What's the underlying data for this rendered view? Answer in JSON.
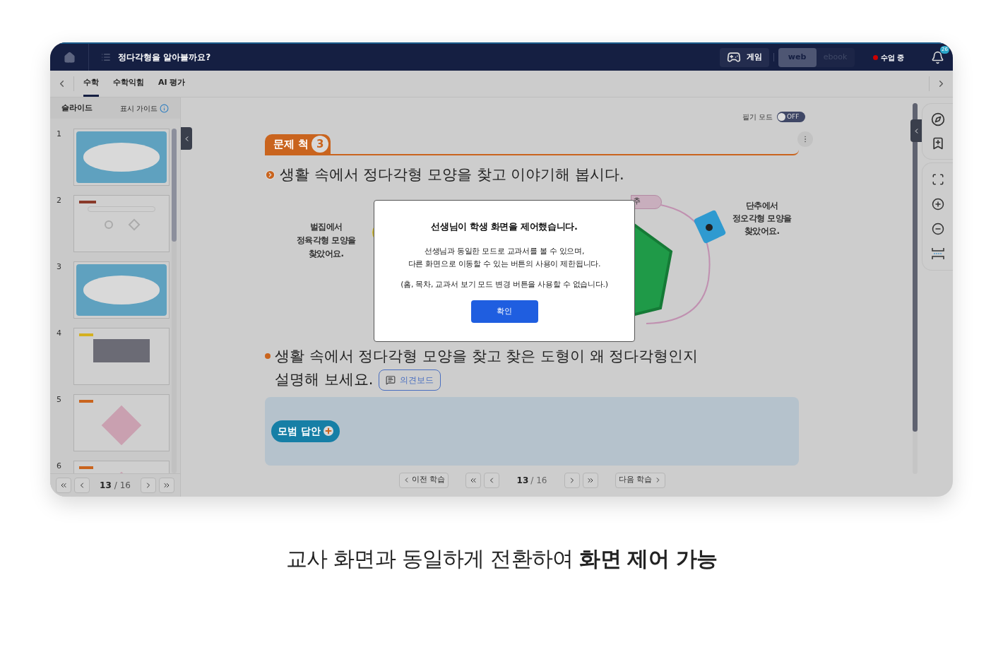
{
  "header": {
    "title": "정다각형을 알아볼까요?",
    "game_button": "게임",
    "view_modes": [
      {
        "label": "web",
        "selected": true
      },
      {
        "label": "ebook",
        "selected": false
      }
    ],
    "status": "수업 중",
    "notification_count": "26"
  },
  "tabs": [
    {
      "label": "수학",
      "selected": true
    },
    {
      "label": "수학익힘",
      "selected": false
    },
    {
      "label": "AI 평가",
      "selected": false
    }
  ],
  "sidebar": {
    "title": "슬라이드",
    "guide": "표시 가이드",
    "slides": [
      {
        "number": "1",
        "kind": "cover"
      },
      {
        "number": "2",
        "kind": "quiz"
      },
      {
        "number": "3",
        "kind": "cover"
      },
      {
        "number": "4",
        "kind": "video"
      },
      {
        "number": "5",
        "kind": "picture"
      },
      {
        "number": "6",
        "kind": "picture"
      }
    ],
    "pager": {
      "current": "13",
      "total": "/ 16"
    }
  },
  "content": {
    "writing_mode": {
      "label": "필기 모드",
      "on": false,
      "state_label": "OFF"
    },
    "problem_badge": {
      "label": "문제 척",
      "number": "3"
    },
    "question_1": "생활 속에서 정다각형 모양을 찾고 이야기해 봅시다.",
    "illustration": {
      "left_caption": "벌집에서\n정육각형 모양을\n찾았어요.",
      "tag": "추",
      "right_caption": "단추에서\n정오각형 모양을\n찾았어요."
    },
    "question_2": "생활 속에서 정다각형 모양을 찾고 찾은 도형이 왜 정다각형인지 설명해 보세요.",
    "opinion_board": "의견보드",
    "model_answer": "모범 답안"
  },
  "bottom_nav": {
    "prev": "이전 학습",
    "current": "13",
    "total": "/ 16",
    "next": "다음 학습"
  },
  "modal": {
    "title": "선생님이 학생 화면을 제어했습니다.",
    "body": "선생님과 동일한 모드로 교과서를 볼 수 있으며,\n다른 화면으로 이동할 수 있는 버튼의 사용이 제한됩니다.",
    "note": "(홈, 목차, 교과서 보기 모드 변경 버튼을 사용할 수 없습니다.)",
    "confirm": "확인"
  },
  "caption": "교사 화면과 동일하게 전환하여 **화면 제어 가능**"
}
